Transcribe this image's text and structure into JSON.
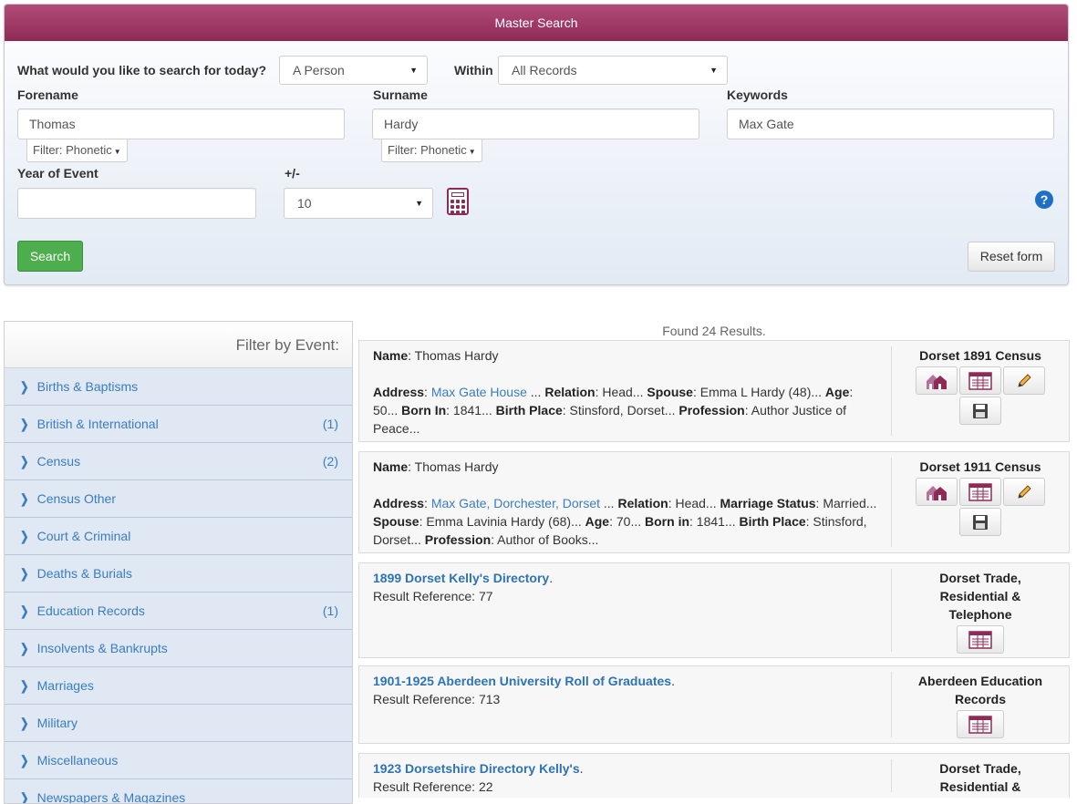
{
  "search": {
    "header_title": "Master Search",
    "question_label": "What would you like to search for today?",
    "search_for_value": "A Person",
    "within_label": "Within",
    "within_value": "All Records",
    "forename_label": "Forename",
    "forename_value": "Thomas",
    "forename_filter": "Filter: Phonetic",
    "surname_label": "Surname",
    "surname_value": "Hardy",
    "surname_filter": "Filter: Phonetic",
    "keywords_label": "Keywords",
    "keywords_value": "Max Gate",
    "year_label": "Year of Event",
    "year_value": "",
    "plusminus_label": "+/-",
    "plusminus_value": "10",
    "help_glyph": "?",
    "search_button": "Search",
    "reset_button": "Reset form"
  },
  "sidebar": {
    "title": "Filter by Event:",
    "chevron": "❯",
    "items": [
      {
        "label": "Births & Baptisms",
        "count": ""
      },
      {
        "label": "British & International",
        "count": "(1)"
      },
      {
        "label": "Census",
        "count": "(2)"
      },
      {
        "label": "Census Other",
        "count": ""
      },
      {
        "label": "Court & Criminal",
        "count": ""
      },
      {
        "label": "Deaths & Burials",
        "count": ""
      },
      {
        "label": "Education Records",
        "count": "(1)"
      },
      {
        "label": "Insolvents & Bankrupts",
        "count": ""
      },
      {
        "label": "Marriages",
        "count": ""
      },
      {
        "label": "Military",
        "count": ""
      },
      {
        "label": "Miscellaneous",
        "count": ""
      },
      {
        "label": "Newspapers & Magazines",
        "count": ""
      }
    ]
  },
  "results": {
    "found_text": "Found 24 Results.",
    "r1": {
      "name_label": "Name",
      "name_value": ": Thomas Hardy",
      "address_label": "Address",
      "address_value": "Max Gate House",
      "relation_label": "Relation",
      "relation_value": ": Head...",
      "spouse_label": "Spouse",
      "spouse_value": ": Emma L Hardy (48)...",
      "age_label": "Age",
      "age_value": ": 50...",
      "born_label": "Born In",
      "born_value": ": 1841...",
      "bplace_label": "Birth Place",
      "bplace_value": ": Stinsford, Dorset...",
      "prof_label": "Profession",
      "prof_value": ": Author Justice of Peace...",
      "source": "Dorset 1891 Census"
    },
    "r2": {
      "name_label": "Name",
      "name_value": ": Thomas Hardy",
      "address_label": "Address",
      "address_value": "Max Gate, Dorchester, Dorset",
      "relation_label": "Relation",
      "relation_value": ": Head...",
      "marital_label": "Marriage Status",
      "marital_value": ": Married...",
      "spouse_label": "Spouse",
      "spouse_value": ": Emma Lavinia Hardy (68)...",
      "age_label": "Age",
      "age_value": ": 70...",
      "born_label": "Born in",
      "born_value": ": 1841...",
      "bplace_label": "Birth Place",
      "bplace_value": ": Stinsford, Dorset...",
      "prof_label": "Profession",
      "prof_value": ": Author of Books...",
      "source": "Dorset 1911 Census"
    },
    "r3": {
      "title": "1899 Dorset Kelly's Directory",
      "ref": "Result Reference: 77",
      "source": "Dorset Trade, Residential & Telephone"
    },
    "r4": {
      "title": "1901-1925 Aberdeen University Roll of Graduates",
      "ref": "Result Reference: 713",
      "source": "Aberdeen Education Records"
    },
    "r5": {
      "title": "1923 Dorsetshire Directory Kelly's",
      "ref": "Result Reference: 22",
      "source": "Dorset Trade, Residential &"
    }
  },
  "icons": {
    "household": "household-icon",
    "transcript": "transcript-icon",
    "edit": "pencil-icon",
    "save": "save-icon",
    "calculator": "calculator-icon",
    "help": "help-icon"
  },
  "colors": {
    "header": "#9b3564",
    "search_button": "#4cae4c",
    "link": "#3a7dc0",
    "icon_accent": "#8f2a57"
  }
}
